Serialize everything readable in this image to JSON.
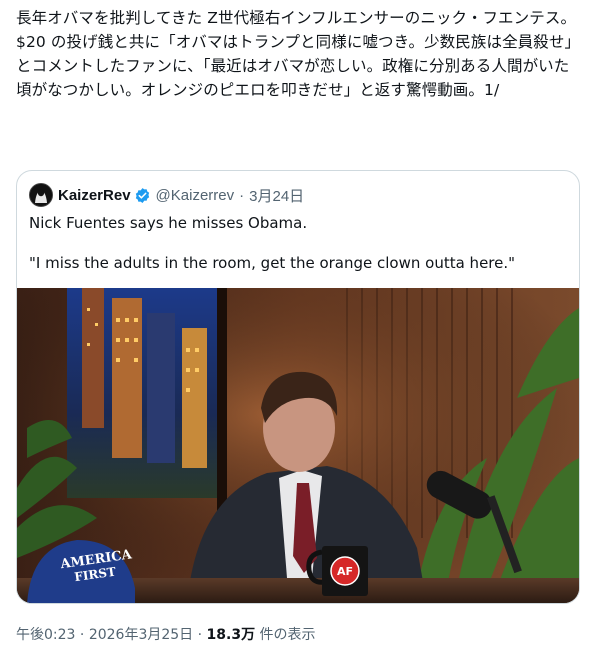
{
  "post": {
    "text_lines": [
      "長年オバマを批判してきた Z世代極右インフルエンサーのニック・フエンテス。",
      "$20 の投げ銭と共に「オバマはトランプと同様に嘘つき。少数民族は全員殺せ」とコメントしたファンに、「最近はオバマが恋しい。政権に分別ある人間がいた頃がなつかしい。オレンジのピエロを叩きだせ」と返す驚愕動画。1/"
    ]
  },
  "quote": {
    "author_name": "KaizerRev",
    "handle": "@Kaizerrev",
    "separator": "·",
    "date": "3月24日",
    "text_line1": "Nick Fuentes says he misses Obama.",
    "text_line2": "\"I miss the adults in the room, get the orange clown outta here.\"",
    "media": {
      "hat_text_line1": "AMERICA",
      "hat_text_line2": "FIRST",
      "mug_text": "AF"
    }
  },
  "meta": {
    "time": "午後0:23",
    "dot": "·",
    "date": "2026年3月25日",
    "dot2": "·",
    "views": "18.3万",
    "views_label": "件の表示"
  },
  "colors": {
    "verified": "#1d9bf0",
    "border": "#cfd9de",
    "secondary_text": "#536471"
  }
}
